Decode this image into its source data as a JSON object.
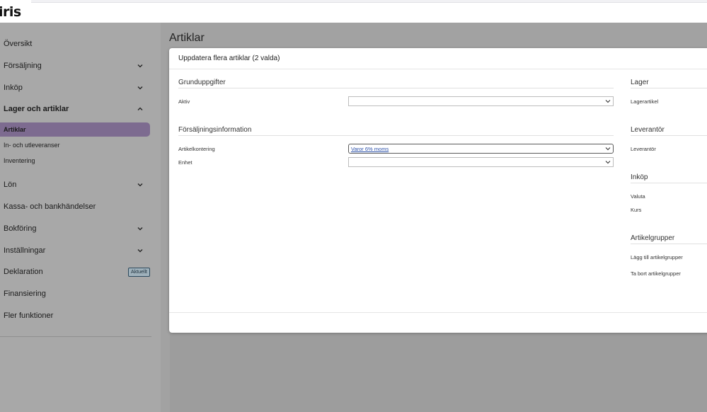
{
  "app": {
    "logo": "iris"
  },
  "sidebar": {
    "items": [
      {
        "label": "Översikt",
        "chevron": ""
      },
      {
        "label": "Försäljning",
        "chevron": "down"
      },
      {
        "label": "Inköp",
        "chevron": "down"
      },
      {
        "label": "Lager och artiklar",
        "chevron": "up",
        "expanded": true
      },
      {
        "label": "Lön",
        "chevron": "down"
      },
      {
        "label": "Kassa- och bankhändelser",
        "chevron": ""
      },
      {
        "label": "Bokföring",
        "chevron": "down"
      },
      {
        "label": "Inställningar",
        "chevron": "down"
      },
      {
        "label": "Deklaration",
        "badge": "Aktuellt"
      },
      {
        "label": "Finansiering",
        "chevron": ""
      },
      {
        "label": "Fler funktioner",
        "chevron": ""
      }
    ],
    "sub_items": [
      {
        "label": "Artiklar",
        "active": true
      },
      {
        "label": "In- och utleveranser",
        "active": false
      },
      {
        "label": "Inventering",
        "active": false
      }
    ]
  },
  "main": {
    "page_title": "Artiklar"
  },
  "modal": {
    "title": "Uppdatera flera artiklar (2 valda)",
    "left": {
      "basic": {
        "title": "Grunduppgifter",
        "aktiv_label": "Aktiv",
        "aktiv_value": ""
      },
      "sales": {
        "title": "Försäljningsinformation",
        "kontering_label": "Artikelkontering",
        "kontering_value": "Varor 6% moms",
        "enhet_label": "Enhet",
        "enhet_value": ""
      }
    },
    "right": {
      "lager": {
        "title": "Lager",
        "field": "Lagerartikel"
      },
      "leverantor": {
        "title": "Leverantör",
        "field": "Leverantör"
      },
      "inkop": {
        "title": "Inköp",
        "valuta": "Valuta",
        "kurs": "Kurs"
      },
      "grupper": {
        "title": "Artikelgrupper",
        "add": "Lägg till artikelgrupper",
        "remove": "Ta bort artikelgrupper"
      }
    }
  }
}
